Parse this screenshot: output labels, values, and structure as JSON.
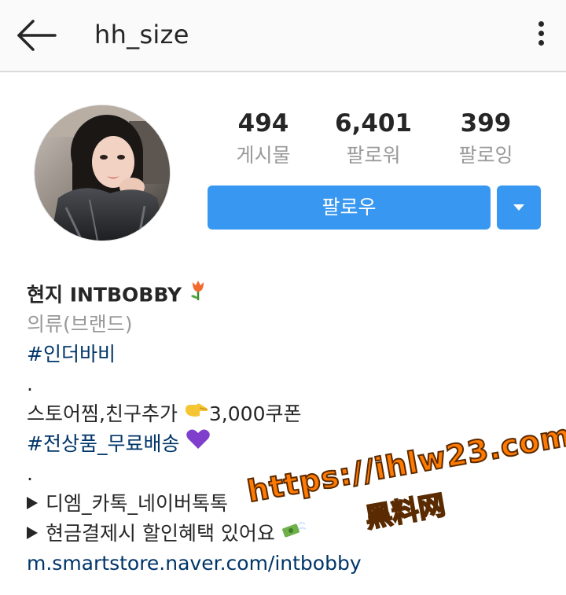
{
  "header": {
    "username": "hh_size",
    "back_icon": "arrow-left-icon",
    "more_icon": "more-vertical-icon"
  },
  "profile": {
    "stats": [
      {
        "count": "494",
        "label": "게시물"
      },
      {
        "count": "6,401",
        "label": "팔로워"
      },
      {
        "count": "399",
        "label": "팔로잉"
      }
    ],
    "follow_label": "팔로우",
    "dropdown_icon": "chevron-down-icon",
    "accent_color": "#3897f0"
  },
  "bio": {
    "name": "현지 INTBOBBY",
    "category": "의류(브랜드)",
    "hashtag_1": "#인더바비",
    "dot_1": ".",
    "line_store": "스토어찜,친구추가 ",
    "line_store_coupon": "3,000쿠폰",
    "hashtag_2": "#전상품_무료배송",
    "dot_2": ".",
    "line_dm": "디엠_카톡_네이버톡톡",
    "line_cash": "현금결제시 할인혜택 있어요",
    "link": "m.smartstore.naver.com/intbobby",
    "emoji_icons": [
      "tulip-icon",
      "pointing-hand-icon",
      "purple-heart-icon",
      "flying-money-icon"
    ]
  },
  "watermark": {
    "url": "https://ihlw23.com",
    "chinese": "黑料网"
  }
}
